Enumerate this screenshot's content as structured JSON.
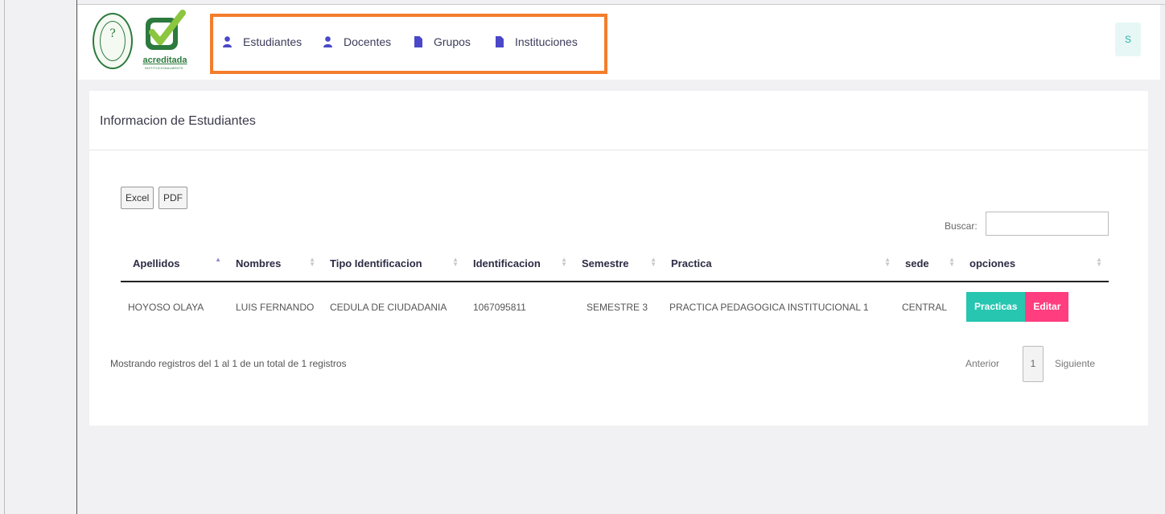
{
  "logo": {
    "seal_mark": "?",
    "badge_word": "acreditada",
    "badge_sub": "INSTITUCIONALMENTE"
  },
  "nav": {
    "items": [
      {
        "label": "Estudiantes",
        "icon": "user-icon"
      },
      {
        "label": "Docentes",
        "icon": "user-icon"
      },
      {
        "label": "Grupos",
        "icon": "file-icon"
      },
      {
        "label": "Instituciones",
        "icon": "file-icon"
      }
    ],
    "avatar_letter": "S"
  },
  "card": {
    "title": "Informacion de Estudiantes"
  },
  "toolbar": {
    "excel_label": "Excel",
    "pdf_label": "PDF",
    "search_label": "Buscar:",
    "search_value": ""
  },
  "table": {
    "columns": [
      "Apellidos",
      "Nombres",
      "Tipo Identificacion",
      "Identificacion",
      "Semestre",
      "Practica",
      "sede",
      "opciones"
    ],
    "rows": [
      {
        "apellidos": "HOYOSO OLAYA",
        "nombres": "LUIS FERNANDO",
        "tipo": "CEDULA DE CIUDADANIA",
        "identificacion": "1067095811",
        "semestre": "SEMESTRE 3",
        "practica": "PRACTICA PEDAGOGICA INSTITUCIONAL 1",
        "sede": "CENTRAL",
        "btn_practicas": "Practicas",
        "btn_editar": "Editar"
      }
    ]
  },
  "footer": {
    "info": "Mostrando registros del 1 al 1 de un total de 1 registros",
    "prev": "Anterior",
    "page": "1",
    "next": "Siguiente"
  },
  "colors": {
    "accent_orange": "#f47d2c",
    "teal": "#26c6b0",
    "pink": "#ff3d7f",
    "nav_icon": "#4a48c8",
    "logo_green": "#2c7a3d"
  }
}
